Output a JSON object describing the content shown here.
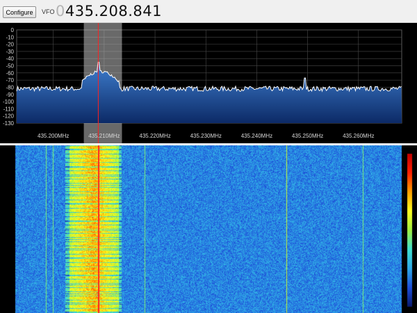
{
  "toolbar": {
    "configure_label": "Configure",
    "vfo_label": "VFO",
    "vfo_prefix": "0",
    "vfo_frequency": "435.208.841"
  },
  "spectrum": {
    "db_ticks": [
      "0",
      "-10",
      "-20",
      "-30",
      "-40",
      "-50",
      "-60",
      "-70",
      "-80",
      "-90",
      "-100",
      "-110",
      "-120",
      "-130"
    ],
    "freq_ticks": [
      "435.200MHz",
      "435.210MHz",
      "435.220MHz",
      "435.230MHz",
      "435.240MHz",
      "435.250MHz",
      "435.260MHz"
    ],
    "tuned_frequency_mhz": 435.208841,
    "passband_mhz": [
      435.206,
      435.2135
    ],
    "noise_floor_db": -82,
    "signal_peak_db": -45,
    "colors": {
      "trace": "#ffffff",
      "fill_top": "#3f7fd0",
      "fill_bottom": "#0c2a66",
      "grid": "#4a4a4a",
      "passband": "#bfbfbf",
      "marker": "#ff2020"
    }
  },
  "waterfall": {
    "colormap": [
      "#0a1a6e",
      "#1e4fd8",
      "#2fa8e8",
      "#40e0d0",
      "#a0f040",
      "#ffff20",
      "#ffa000",
      "#ff2000",
      "#c00000"
    ]
  }
}
